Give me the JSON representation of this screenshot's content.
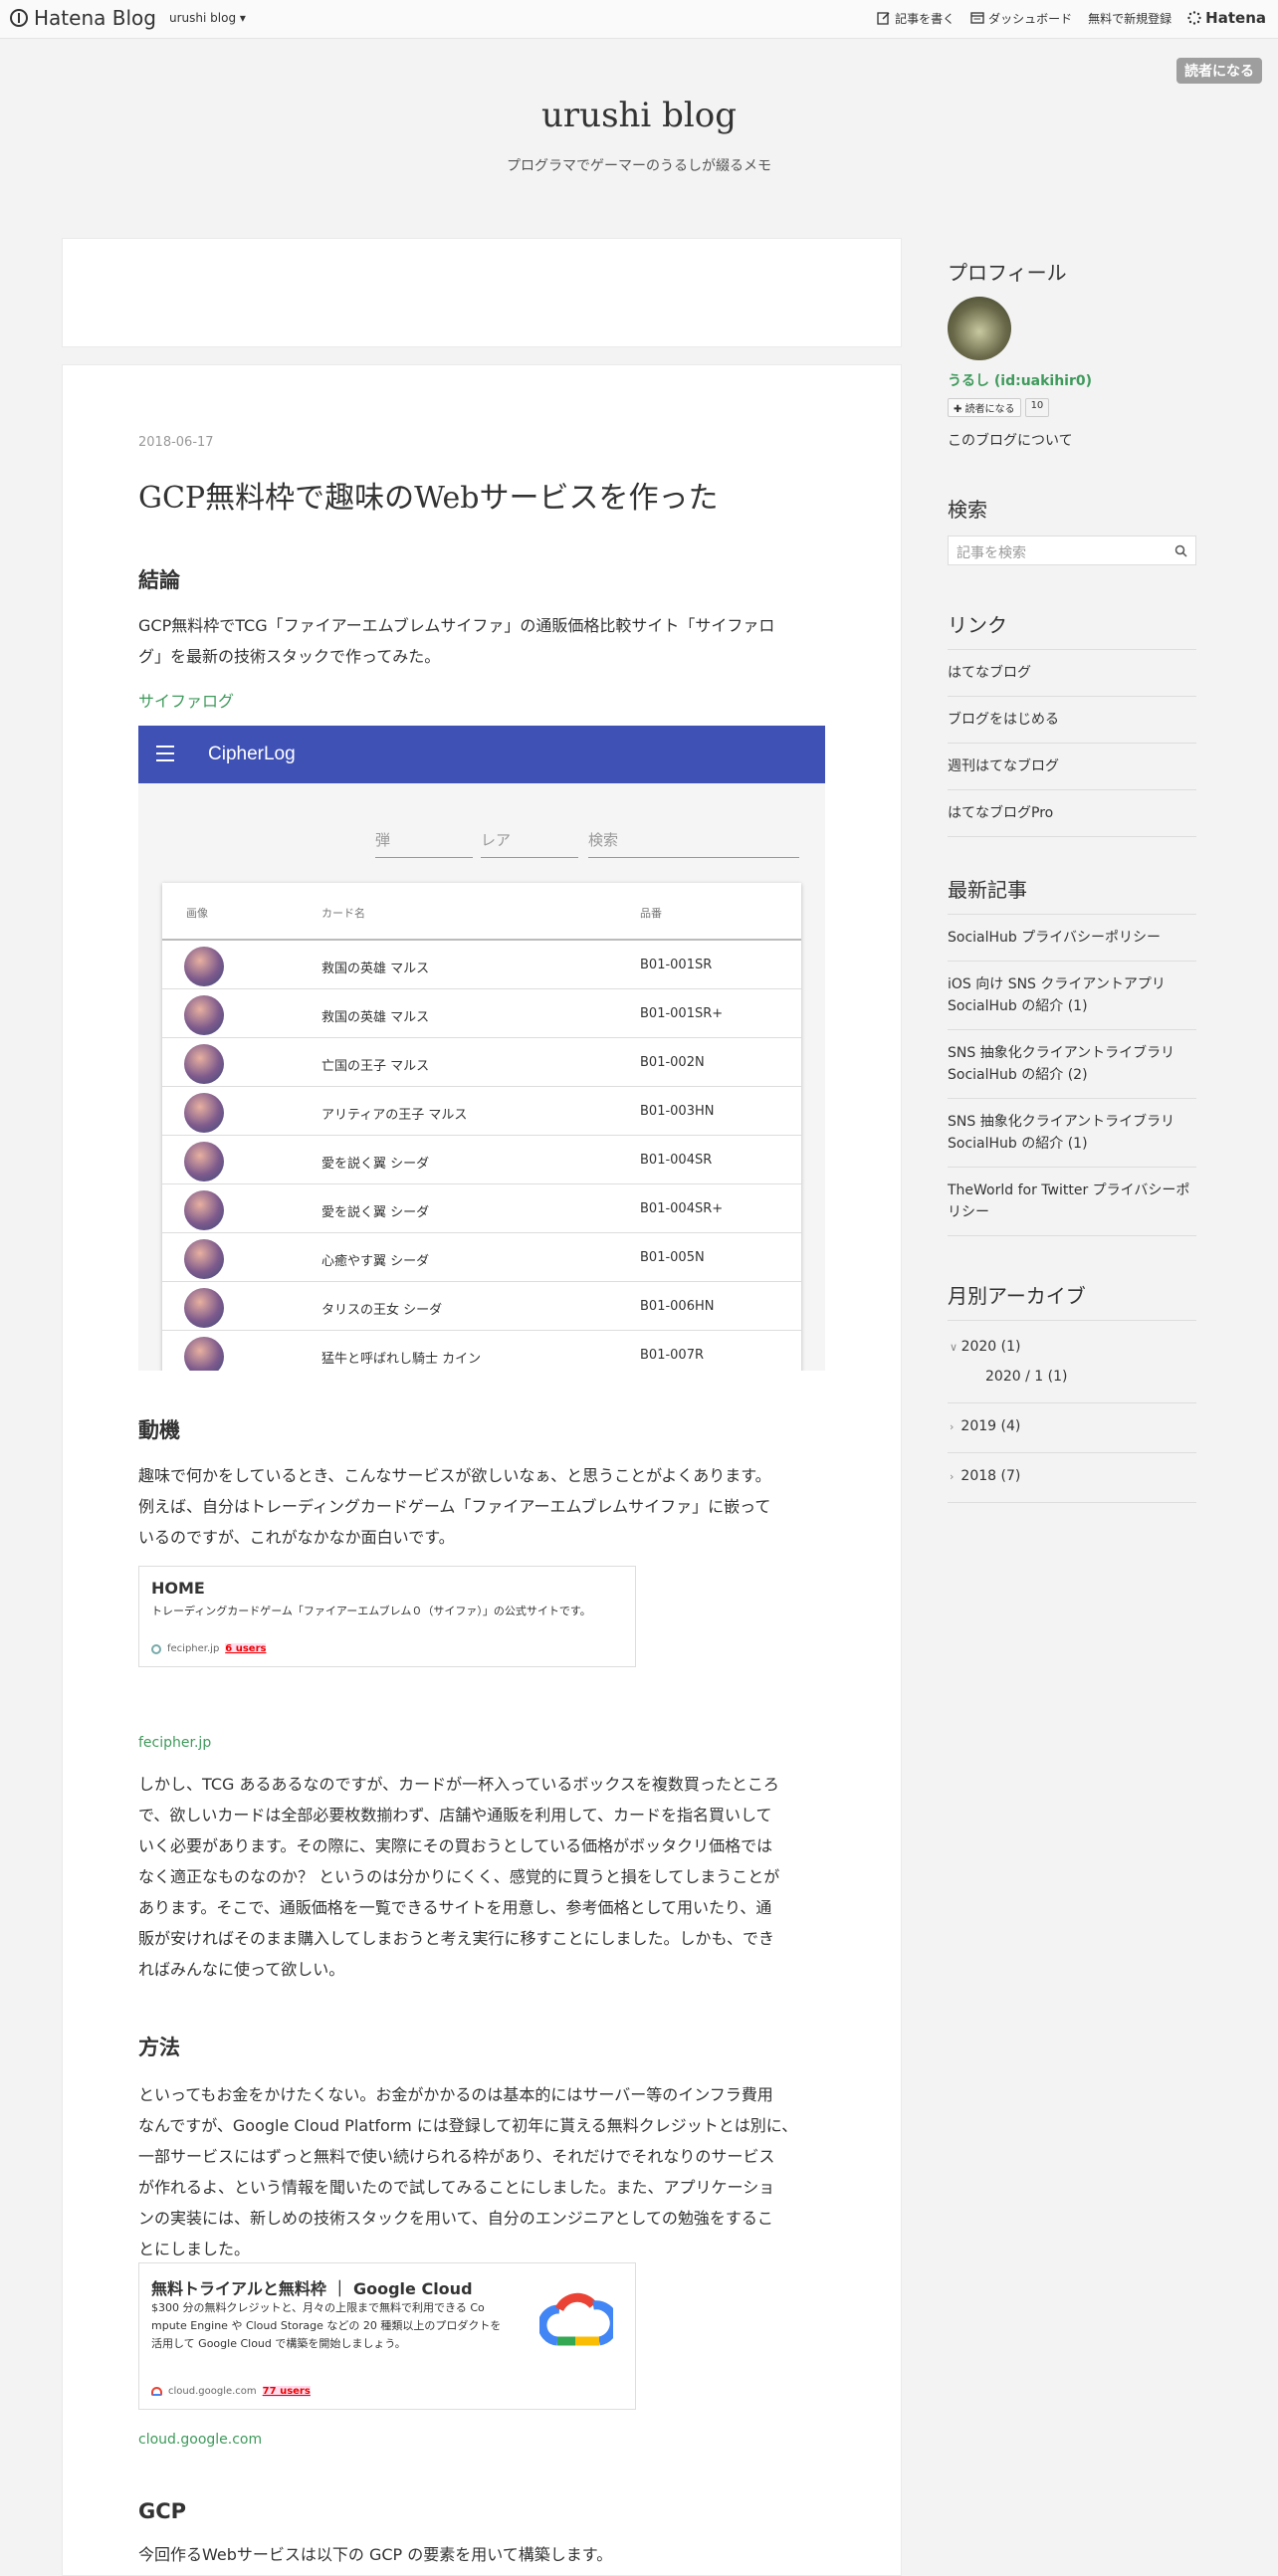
{
  "topbar": {
    "logo": "Hatena Blog",
    "blog_selector": "urushi blog ▾",
    "write": "記事を書く",
    "dashboard": "ダッシュボード",
    "signup": "無料で新規登録",
    "hatena": "Hatena"
  },
  "subscribe_button": "読者になる",
  "blog": {
    "title": "urushi blog",
    "description": "プログラマでゲーマーのうるしが綴るメモ"
  },
  "entry": {
    "date": "2018-06-17",
    "title": "GCP無料枠で趣味のWebサービスを作った",
    "sections": {
      "conclusion_heading": "結論",
      "conclusion_text": [
        "GCP無料枠でTCG「ファイアーエムブレムサイファ」の通販価格比較サイト「サイファロ",
        "グ」を最新の技術スタックで作ってみた。"
      ],
      "cipherlog_link": "サイファログ",
      "motive_heading": "動機",
      "motive_text": [
        "趣味で何かをしているとき、こんなサービスが欲しいなぁ、と思うことがよくあります。",
        "例えば、自分はトレーディングカードゲーム「ファイアーエムブレムサイファ」に嵌って",
        "いるのですが、これがなかなか面白いです。"
      ],
      "fecipher_link": "fecipher.jp",
      "body_text": [
        "しかし、TCG あるあるなのですが、カードが一杯入っているボックスを複数買ったところ",
        "で、欲しいカードは全部必要枚数揃わず、店舗や通販を利用して、カードを指名買いして",
        "いく必要があります。その際に、実際にその買おうとしている価格がボッタクリ価格では",
        "なく適正なものなのか？ というのは分かりにくく、感覚的に買うと損をしてしまうことが",
        "あります。そこで、通販価格を一覧できるサイトを用意し、参考価格として用いたり、通",
        "販が安ければそのまま購入してしまおうと考え実行に移すことにしました。しかも、でき",
        "ればみんなに使って欲しい。"
      ],
      "method_heading": "方法",
      "method_text": [
        "といってもお金をかけたくない。お金がかかるのは基本的にはサーバー等のインフラ費用",
        "なんですが、Google Cloud Platform には登録して初年に貰える無料クレジットとは別に、",
        "一部サービスにはずっと無料で使い続けられる枠があり、それだけでそれなりのサービス",
        "が作れるよ、という情報を聞いたので試してみることにしました。また、アプリケーショ",
        "ンの実装には、新しめの技術スタックを用いて、自分のエンジニアとしての勉強をするこ",
        "とにしました。"
      ],
      "gcloud_link": "cloud.google.com",
      "gcp_heading": "GCP",
      "gcp_text": "今回作るWebサービスは以下の GCP の要素を用いて構築します。"
    }
  },
  "app_screenshot": {
    "app_name": "CipherLog",
    "filters": [
      "弾",
      "レア",
      "検索"
    ],
    "columns": [
      "画像",
      "カード名",
      "品番"
    ],
    "rows": [
      {
        "name": "救国の英雄 マルス",
        "code": "B01-001SR"
      },
      {
        "name": "救国の英雄 マルス",
        "code": "B01-001SR+"
      },
      {
        "name": "亡国の王子 マルス",
        "code": "B01-002N"
      },
      {
        "name": "アリティアの王子 マルス",
        "code": "B01-003HN"
      },
      {
        "name": "愛を説く翼 シーダ",
        "code": "B01-004SR"
      },
      {
        "name": "愛を説く翼 シーダ",
        "code": "B01-004SR+"
      },
      {
        "name": "心癒やす翼 シーダ",
        "code": "B01-005N"
      },
      {
        "name": "タリスの王女 シーダ",
        "code": "B01-006HN"
      },
      {
        "name": "猛牛と呼ばれし騎士 カイン",
        "code": "B01-007R"
      }
    ],
    "accent_color": "#3f51b5"
  },
  "link_cards": {
    "fecipher": {
      "title": "HOME",
      "description": "トレーディングカードゲーム「ファイアーエムブレム０（サイファ）」の公式サイトです。",
      "domain": "fecipher.jp",
      "users": "6 users"
    },
    "gcloud": {
      "title": "無料トライアルと無料枠 ｜ Google Cloud",
      "description": [
        "$300 分の無料クレジットと、月々の上限まで無料で利用できる Co",
        "mpute Engine や Cloud Storage などの 20 種類以上のプロダクトを",
        "活用して Google Cloud で構築を開始しましょう。"
      ],
      "domain": "cloud.google.com",
      "users": "77 users"
    }
  },
  "sidebar": {
    "profile_heading": "プロフィール",
    "profile_name": "うるし (id:uakihir0)",
    "subscribe_small": "読者になる",
    "subscriber_count": "10",
    "about": "このブログについて",
    "search_heading": "検索",
    "search_placeholder": "記事を検索",
    "links_heading": "リンク",
    "links": [
      "はてなブログ",
      "ブログをはじめる",
      "週刊はてなブログ",
      "はてなブログPro"
    ],
    "recent_heading": "最新記事",
    "recent": [
      "SocialHub プライバシーポリシー",
      "iOS 向け SNS クライアントアプリ SocialHub の紹介 (1)",
      "SNS 抽象化クライアントライブラリ SocialHub の紹介 (2)",
      "SNS 抽象化クライアントライブラリ SocialHub の紹介 (1)",
      "TheWorld for Twitter プライバシーポリシー"
    ],
    "archive_heading": "月別アーカイブ",
    "archive": {
      "y2020": "2020 (1)",
      "m2020_1": "2020 / 1 (1)",
      "y2019": "2019 (4)",
      "y2018": "2018 (7)"
    }
  }
}
